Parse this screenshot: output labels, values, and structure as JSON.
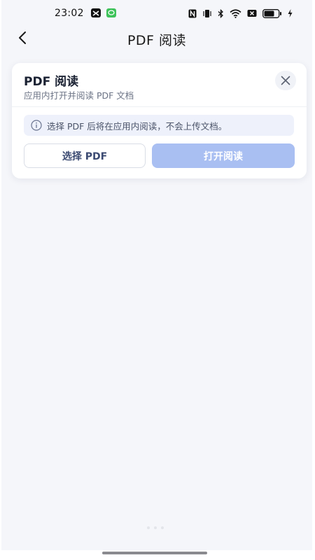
{
  "status_bar": {
    "time": "23:02",
    "icons": [
      "capcut-icon",
      "message-icon",
      "nfc-icon",
      "vibrate-icon",
      "bluetooth-icon",
      "wifi-icon",
      "sim-off-icon",
      "battery-icon",
      "charging-icon"
    ]
  },
  "nav": {
    "title": "PDF 阅读",
    "back_icon": "chevron-left-icon"
  },
  "card": {
    "title": "PDF 阅读",
    "subtitle": "应用内打开并阅读 PDF 文档",
    "close_icon": "close-icon",
    "notice": {
      "icon": "info-icon",
      "text": "选择 PDF 后将在应用内阅读，不会上传文档。"
    },
    "select_button": "选择 PDF",
    "open_button": "打开阅读"
  },
  "colors": {
    "background": "#f5f6fa",
    "card": "#ffffff",
    "notice_bg": "#eef1fb",
    "primary_disabled": "#a9bff2",
    "secondary_text": "#3b4a72"
  }
}
